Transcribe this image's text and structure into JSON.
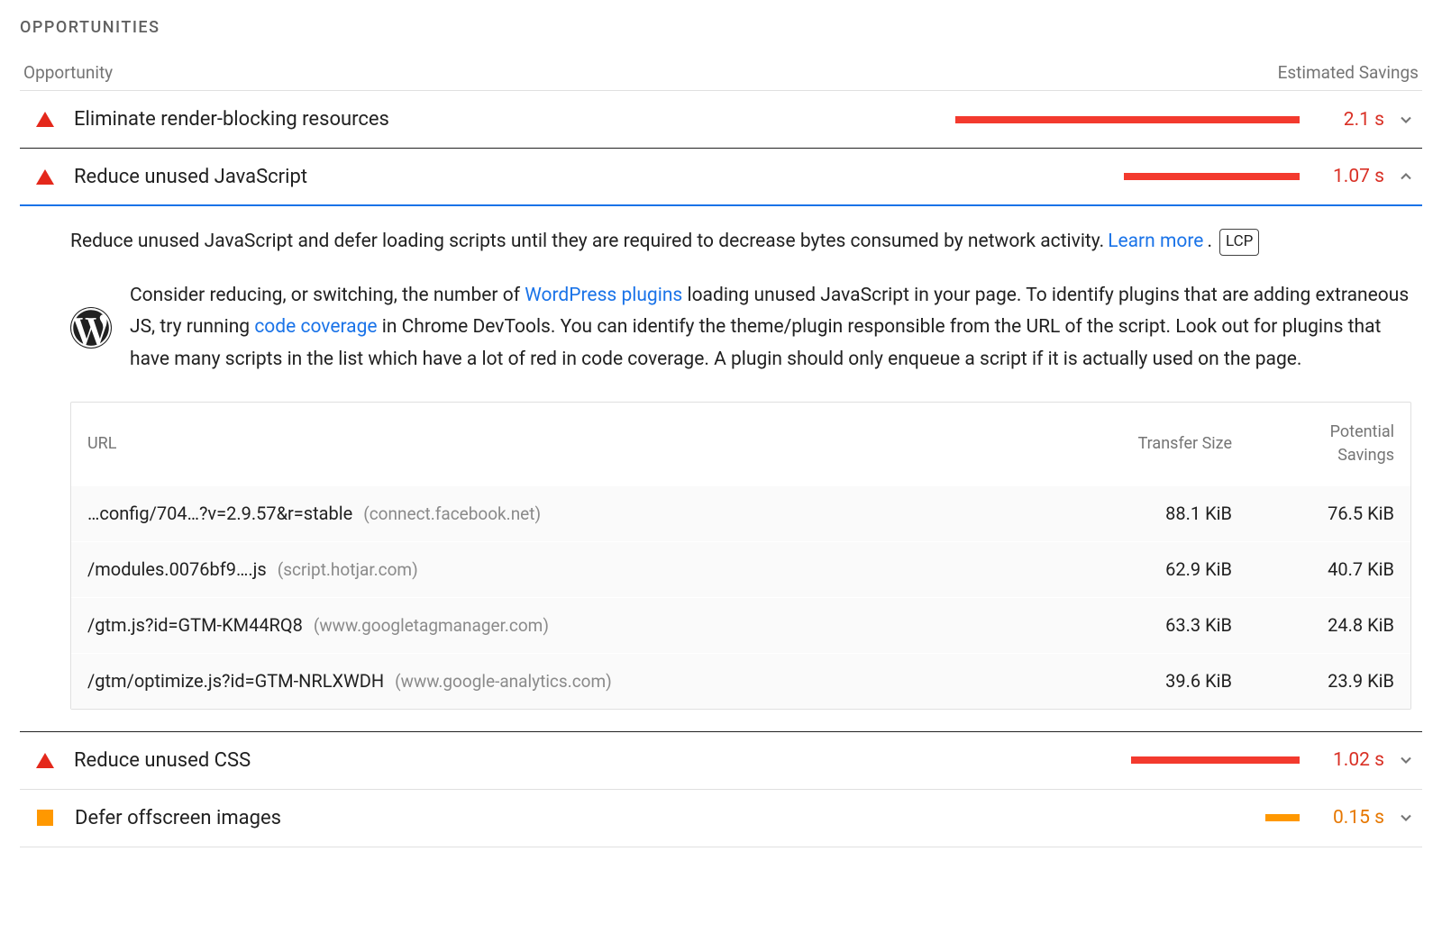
{
  "section_title": "OPPORTUNITIES",
  "columns": {
    "opportunity": "Opportunity",
    "savings": "Estimated Savings"
  },
  "opportunities": [
    {
      "label": "Eliminate render-blocking resources",
      "severity": "high",
      "savings": "2.1 s",
      "bar_pct": 100,
      "expanded": false
    },
    {
      "label": "Reduce unused JavaScript",
      "severity": "high",
      "savings": "1.07 s",
      "bar_pct": 51,
      "expanded": true
    },
    {
      "label": "Reduce unused CSS",
      "severity": "high",
      "savings": "1.02 s",
      "bar_pct": 49,
      "expanded": false
    },
    {
      "label": "Defer offscreen images",
      "severity": "medium",
      "savings": "0.15 s",
      "bar_pct": 10,
      "expanded": false
    }
  ],
  "detail": {
    "desc_prefix": "Reduce unused JavaScript and defer loading scripts until they are required to decrease bytes consumed by network activity. ",
    "learn_more": "Learn more",
    "desc_suffix": ".",
    "lcp": "LCP",
    "wp_t1": "Consider reducing, or switching, the number of ",
    "wp_link1": "WordPress plugins",
    "wp_t2": " loading unused JavaScript in your page. To identify plugins that are adding extraneous JS, try running ",
    "wp_link2": "code coverage",
    "wp_t3": " in Chrome DevTools. You can identify the theme/plugin responsible from the URL of the script. Look out for plugins that have many scripts in the list which have a lot of red in code coverage. A plugin should only enqueue a script if it is actually used on the page."
  },
  "table": {
    "headers": {
      "url": "URL",
      "transfer": "Transfer Size",
      "savings": "Potential Savings"
    },
    "rows": [
      {
        "path": "…config/704…?v=2.9.57&r=stable",
        "host": "(connect.facebook.net)",
        "transfer": "88.1 KiB",
        "savings": "76.5 KiB"
      },
      {
        "path": "/modules.0076bf9….js",
        "host": "(script.hotjar.com)",
        "transfer": "62.9 KiB",
        "savings": "40.7 KiB"
      },
      {
        "path": "/gtm.js?id=GTM-KM44RQ8",
        "host": "(www.googletagmanager.com)",
        "transfer": "63.3 KiB",
        "savings": "24.8 KiB"
      },
      {
        "path": "/gtm/optimize.js?id=GTM-NRLXWDH",
        "host": "(www.google-analytics.com)",
        "transfer": "39.6 KiB",
        "savings": "23.9 KiB"
      }
    ]
  }
}
